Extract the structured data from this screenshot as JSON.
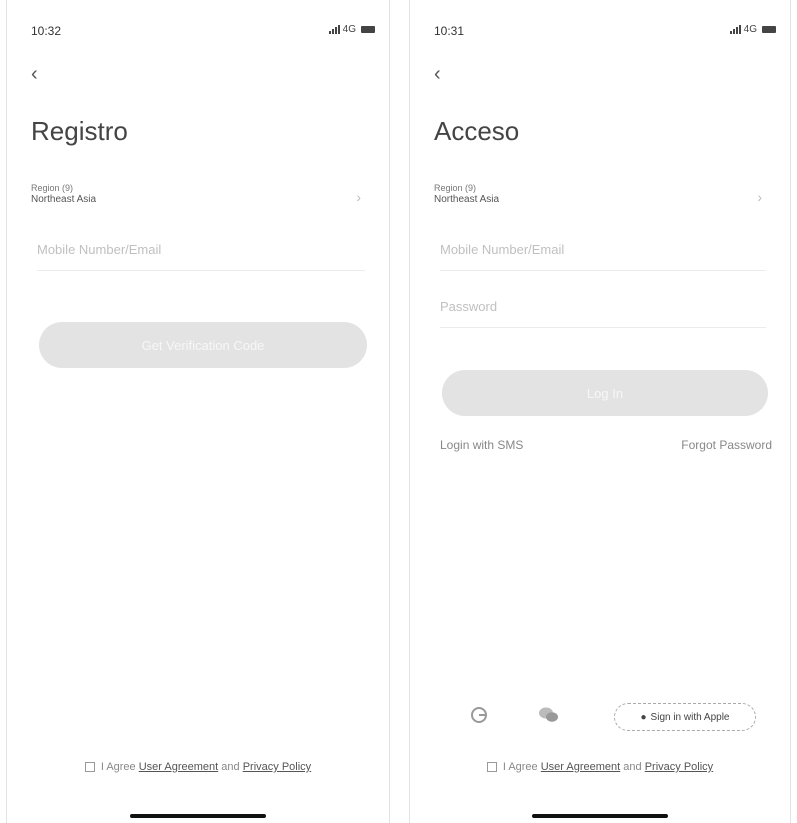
{
  "left": {
    "status_time": "10:32",
    "network": "4G",
    "title": "Registro",
    "region_label": "Region (9)",
    "region_value": "Northeast Asia",
    "contact_placeholder": "Mobile Number/Email",
    "primary_button": "Get Verification Code",
    "consent_prefix": "I Agree",
    "consent_link1": "User Agreement",
    "consent_and": "and",
    "consent_link2": "Privacy Policy"
  },
  "right": {
    "status_time": "10:31",
    "network": "4G",
    "title": "Acceso",
    "region_label": "Region (9)",
    "region_value": "Northeast Asia",
    "contact_placeholder": "Mobile Number/Email",
    "password_placeholder": "Password",
    "primary_button": "Log In",
    "login_sms": "Login with SMS",
    "forgot_password": "Forgot Password",
    "apple_button": "Sign in with Apple",
    "consent_prefix": "I Agree",
    "consent_link1": "User Agreement",
    "consent_and": "and",
    "consent_link2": "Privacy Policy"
  },
  "icons": {
    "back": "back-arrow-icon",
    "chevron": "chevron-right-icon",
    "google": "google-icon",
    "wechat": "wechat-icon",
    "apple": "apple-icon"
  },
  "colors": {
    "button_disabled": "#e3e3e3",
    "text_muted": "#888888"
  }
}
